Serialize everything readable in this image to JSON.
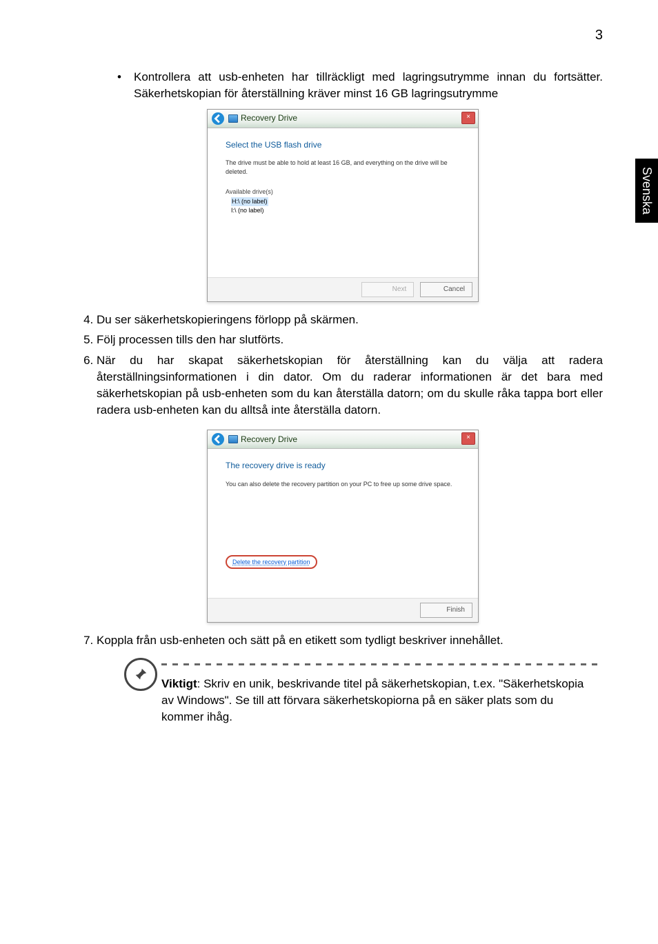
{
  "page_number": "3",
  "side_tab": "Svenska",
  "bullet_text": "Kontrollera att usb-enheten har tillräckligt med lagringsutrymme innan du fortsätter. Säkerhetskopian för återställning kräver minst 16 GB lagringsutrymme",
  "dialog1": {
    "title": "Recovery Drive",
    "heading": "Select the USB flash drive",
    "desc": "The drive must be able to hold at least 16 GB, and everything on the drive will be deleted.",
    "section_label": "Available drive(s)",
    "drive_selected": "H:\\ (no label)",
    "drive_other": "I:\\ (no label)",
    "btn_next": "Next",
    "btn_cancel": "Cancel"
  },
  "steps": {
    "s4": "Du ser säkerhetskopieringens förlopp på skärmen.",
    "s5": "Följ processen tills den har slutförts.",
    "s6": "När du har skapat säkerhetskopian för återställning kan du välja att radera återställningsinformationen i din dator. Om du raderar informationen är det bara med säkerhetskopian på usb-enheten som du kan återställa datorn; om du skulle råka tappa bort eller radera usb-enheten kan du alltså inte återställa datorn.",
    "s7": "Koppla från usb-enheten och sätt på en etikett som tydligt beskriver innehållet."
  },
  "dialog2": {
    "title": "Recovery Drive",
    "heading": "The recovery drive is ready",
    "desc": "You can also delete the recovery partition on your PC to free up some drive space.",
    "link": "Delete the recovery partition",
    "btn_finish": "Finish"
  },
  "note": {
    "bold": "Viktigt",
    "text": ": Skriv en unik, beskrivande titel på säkerhetskopian, t.ex. \"Säkerhetskopia av Windows\". Se till att förvara säkerhetskopiorna på en säker plats som du kommer ihåg."
  }
}
